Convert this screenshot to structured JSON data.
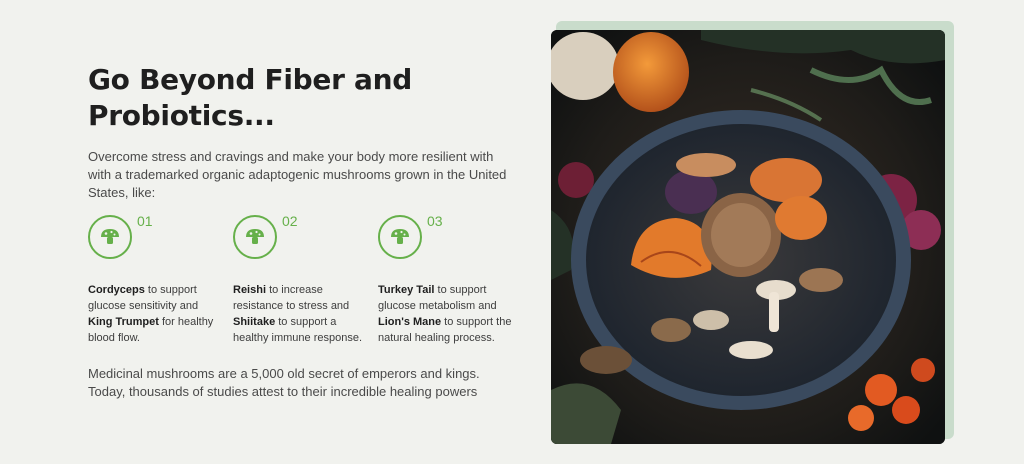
{
  "section": {
    "headline_line1": "Go Beyond Fiber and",
    "headline_line2": "Probiotics...",
    "intro": "Overcome stress and cravings and make your body more resilient with with a trademarked organic adaptogenic mushrooms grown in the United States, like:",
    "closing": "Medicinal mushrooms are a 5,000 old secret of emperors and kings. Today, thousands of studies attest to their incredible healing powers"
  },
  "features": [
    {
      "number": "01",
      "icon": "mushroom-icon",
      "a_name": "Cordyceps",
      "a_rest": " to support glucose sensitivity and ",
      "b_name": "King Trumpet",
      "b_rest": " for healthy blood flow."
    },
    {
      "number": "02",
      "icon": "mushroom-icon",
      "a_name": "Reishi",
      "a_rest": " to increase resistance to stress and ",
      "b_name": "Shiitake",
      "b_rest": " to support a healthy immune response."
    },
    {
      "number": "03",
      "icon": "mushroom-icon",
      "a_name": "Turkey Tail",
      "a_rest": " to support glucose metabolism and ",
      "b_name": "Lion's Mane",
      "b_rest": " to support the natural healing process."
    }
  ],
  "colors": {
    "accent": "#66b04a",
    "background": "#f1f2ee",
    "photo_frame": "#c9dccb",
    "heading": "#1f1f1f"
  },
  "image": {
    "subject": "bowl of assorted mushrooms"
  }
}
